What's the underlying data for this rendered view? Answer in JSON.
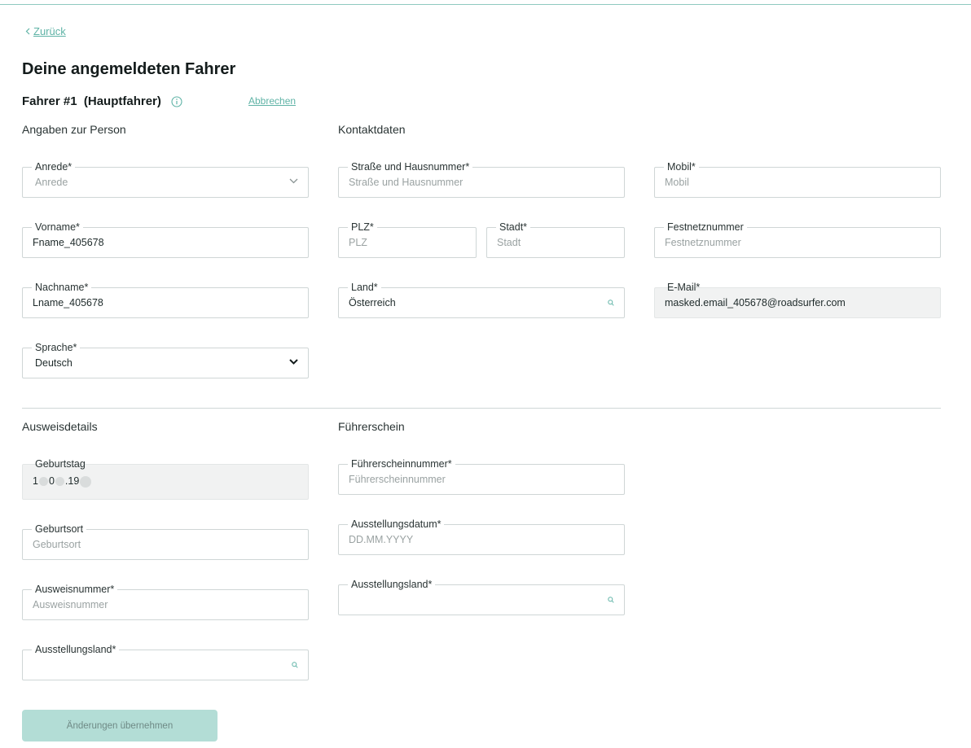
{
  "nav": {
    "back_label": "Zurück"
  },
  "page": {
    "title": "Deine angemeldeten Fahrer"
  },
  "driver": {
    "title": "Fahrer #1  (Hauptfahrer)",
    "cancel_label": "Abbrechen"
  },
  "sections": {
    "person": "Angaben zur Person",
    "contact": "Kontaktdaten",
    "id_details": "Ausweisdetails",
    "license": "Führerschein"
  },
  "fields": {
    "salutation": {
      "label": "Anrede*",
      "value": "Anrede"
    },
    "first_name": {
      "label": "Vorname*",
      "value": "Fname_405678"
    },
    "last_name": {
      "label": "Nachname*",
      "value": "Lname_405678"
    },
    "language": {
      "label": "Sprache*",
      "value": "Deutsch"
    },
    "street": {
      "label": "Straße und Hausnummer*",
      "value": "Straße und Hausnummer"
    },
    "zip": {
      "label": "PLZ*",
      "value": "PLZ"
    },
    "city": {
      "label": "Stadt*",
      "value": "Stadt"
    },
    "country": {
      "label": "Land*",
      "value": "Österreich"
    },
    "mobile": {
      "label": "Mobil*",
      "value": "Mobil"
    },
    "landline": {
      "label": "Festnetznummer",
      "value": "Festnetznummer"
    },
    "email": {
      "label": "E-Mail*",
      "value": "masked.email_405678@roadsurfer.com"
    },
    "birthday": {
      "label": "Geburtstag",
      "value_a": "1",
      "value_b": "0",
      "value_c": ".19"
    },
    "birthplace": {
      "label": "Geburtsort",
      "value": "Geburtsort"
    },
    "id_number": {
      "label": "Ausweisnummer*",
      "value": "Ausweisnummer"
    },
    "id_issuing_country": {
      "label": "Ausstellungsland*",
      "value": ""
    },
    "license_number": {
      "label": "Führerscheinnummer*",
      "value": "Führerscheinnummer"
    },
    "license_issue_date": {
      "label": "Ausstellungsdatum*",
      "value": "DD.MM.YYYY"
    },
    "license_issuing_country": {
      "label": "Ausstellungsland*",
      "value": ""
    }
  },
  "actions": {
    "submit_label": "Änderungen übernehmen"
  },
  "colors": {
    "accent": "#5fb3a6",
    "button_disabled_bg": "#b3ddd6",
    "border": "#cfd6d6",
    "disabled_field_bg": "#f1f2f2"
  },
  "icons": [
    "chevron-left-icon",
    "info-icon",
    "chevron-down-icon",
    "search-icon"
  ]
}
